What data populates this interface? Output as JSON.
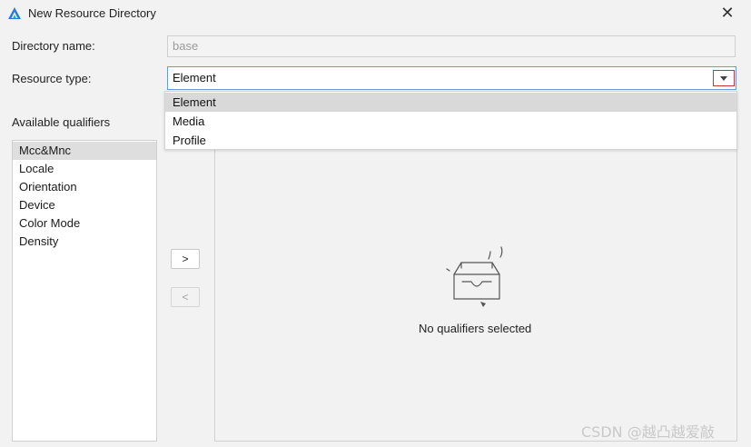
{
  "window": {
    "title": "New Resource Directory",
    "icon": "deveco-logo-icon",
    "close_glyph": "✕"
  },
  "form": {
    "directory_name_label": "Directory name:",
    "directory_name_value": "base",
    "resource_type_label": "Resource type:",
    "resource_type_value": "Element"
  },
  "dropdown": {
    "options": [
      {
        "label": "Element",
        "selected": true
      },
      {
        "label": "Media",
        "selected": false
      },
      {
        "label": "Profile",
        "selected": false
      }
    ]
  },
  "qualifiers": {
    "available_label": "Available qualifiers",
    "items": [
      {
        "label": "Mcc&Mnc",
        "selected": true
      },
      {
        "label": "Locale",
        "selected": false
      },
      {
        "label": "Orientation",
        "selected": false
      },
      {
        "label": "Device",
        "selected": false
      },
      {
        "label": "Color Mode",
        "selected": false
      },
      {
        "label": "Density",
        "selected": false
      }
    ],
    "add_button_label": ">",
    "remove_button_label": "<",
    "empty_message": "No qualifiers selected",
    "empty_icon": "empty-tray-icon"
  },
  "watermark": {
    "text": "CSDN @越凸越爱敲"
  },
  "colors": {
    "accent_border": "#6b9bd6",
    "arrow_highlight": "#c0393b",
    "selection_bg": "#d9d9d9"
  }
}
